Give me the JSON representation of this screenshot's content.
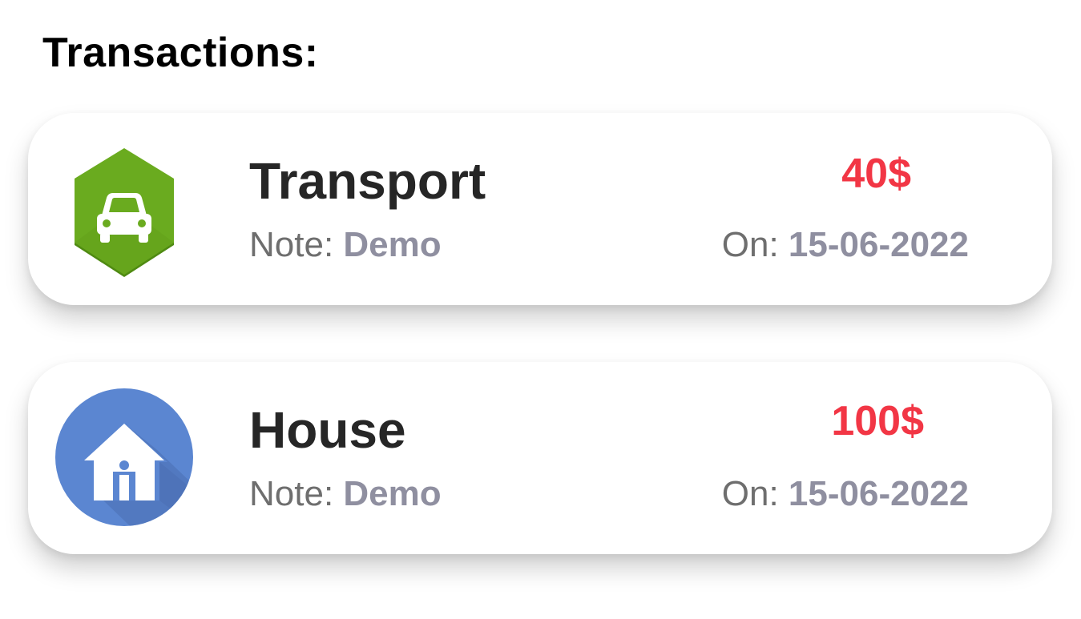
{
  "title": "Transactions:",
  "transactions": [
    {
      "category": "Transport",
      "icon": "car-icon",
      "icon_color": "#6aab1f",
      "note_label": "Note:",
      "note": "Demo",
      "amount": "40$",
      "date_label": "On:",
      "date": "15-06-2022"
    },
    {
      "category": "House",
      "icon": "house-icon",
      "icon_color": "#5b86d1",
      "note_label": "Note:",
      "note": "Demo",
      "amount": "100$",
      "date_label": "On:",
      "date": "15-06-2022"
    }
  ],
  "colors": {
    "amount": "#f23645",
    "value_text": "#8f8fa0",
    "label_text": "#6e6e6e"
  }
}
